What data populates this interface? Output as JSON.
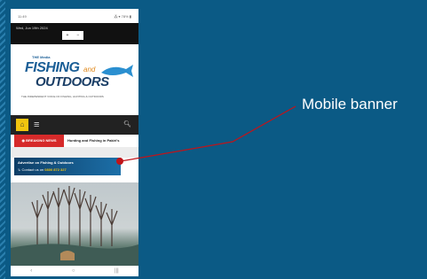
{
  "status_bar": {
    "time": "11:49",
    "icons": "⁂ ▾ 78% ▮"
  },
  "date_bar": {
    "date": "Wed, Jun 19th 2024",
    "ctrl_left": "+",
    "ctrl_right": "−"
  },
  "logo": {
    "small": "THE Media",
    "fishing": "FISHING",
    "and": "and",
    "outdoors": "OUTDOORS",
    "tagline": "THE INDEPENDENT VOICE OF FISHING, HUNTING & OUTDOORS"
  },
  "nav": {
    "home_icon": "home-icon",
    "menu_icon": "menu-icon",
    "search_icon": "search-icon"
  },
  "news": {
    "tag": "◉ BREAKING NEWS",
    "headline": "Hunting and Fishing in Pakiri's"
  },
  "banner": {
    "line1": "Advertise on Fishing & Outdoors",
    "line2_prefix": "↳ Contact us on ",
    "line2_phone": "0800 872 327"
  },
  "bottom_nav": {
    "back": "‹",
    "home": "○",
    "recent": "|||"
  },
  "callout": {
    "label": "Mobile banner",
    "color": "#c0141a"
  },
  "colors": {
    "background": "#0b5a85",
    "accent": "#f1c40f",
    "brand_blue": "#1a5e96",
    "news_red": "#d62a2a"
  }
}
